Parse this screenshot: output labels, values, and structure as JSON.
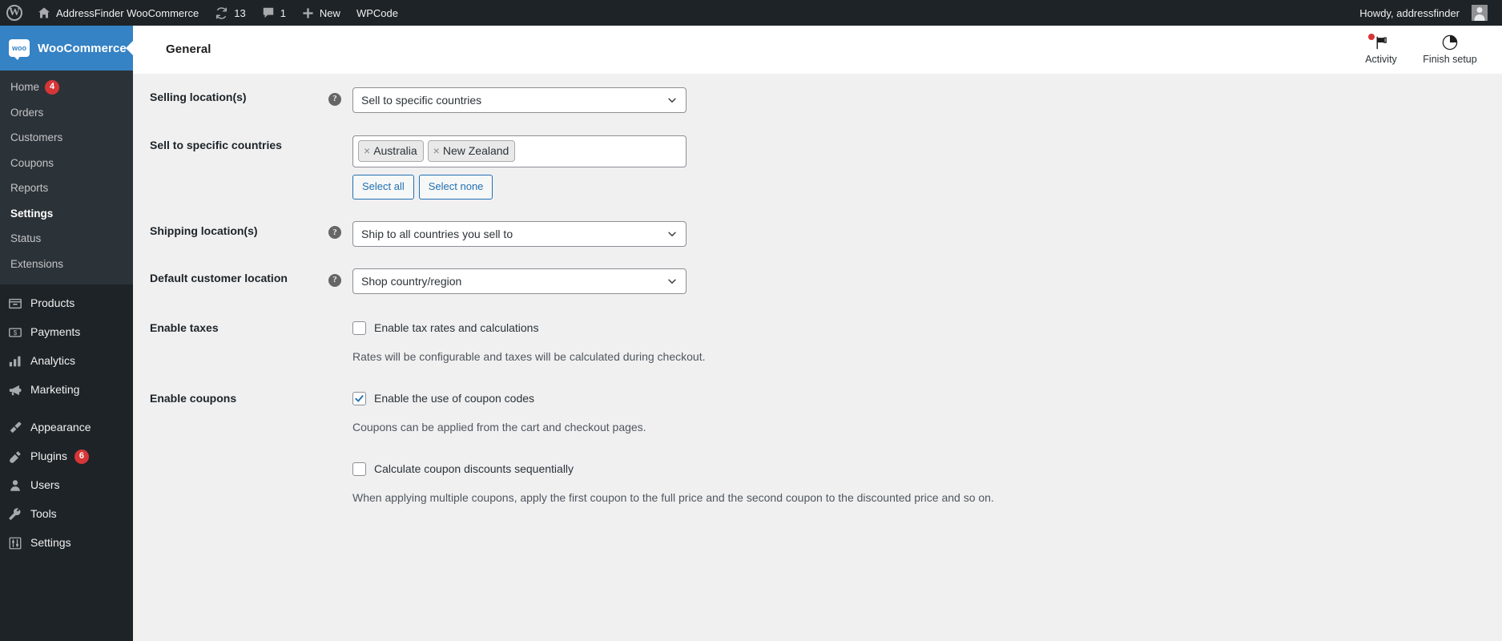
{
  "adminbar": {
    "site_name": "AddressFinder WooCommerce",
    "updates_count": "13",
    "comments_count": "1",
    "new_label": "New",
    "wpcode_label": "WPCode",
    "howdy": "Howdy, addressfinder",
    "icons": {
      "wp_logo": "wordpress-logo-icon",
      "home": "home-icon",
      "updates": "updates-icon",
      "comments": "comments-icon",
      "new": "plus-icon",
      "avatar": "avatar"
    }
  },
  "sidebar": {
    "brand": "WooCommerce",
    "submenu": [
      {
        "label": "Home",
        "badge": "4",
        "current": false
      },
      {
        "label": "Orders",
        "badge": "",
        "current": false
      },
      {
        "label": "Customers",
        "badge": "",
        "current": false
      },
      {
        "label": "Coupons",
        "badge": "",
        "current": false
      },
      {
        "label": "Reports",
        "badge": "",
        "current": false
      },
      {
        "label": "Settings",
        "badge": "",
        "current": true
      },
      {
        "label": "Status",
        "badge": "",
        "current": false
      },
      {
        "label": "Extensions",
        "badge": "",
        "current": false
      }
    ],
    "menu": [
      {
        "label": "Products",
        "icon": "products-icon",
        "badge": ""
      },
      {
        "label": "Payments",
        "icon": "payments-icon",
        "badge": ""
      },
      {
        "label": "Analytics",
        "icon": "analytics-icon",
        "badge": ""
      },
      {
        "label": "Marketing",
        "icon": "marketing-megaphone-icon",
        "badge": ""
      },
      {
        "label": "Appearance",
        "icon": "appearance-brush-icon",
        "badge": ""
      },
      {
        "label": "Plugins",
        "icon": "plugins-icon",
        "badge": "6"
      },
      {
        "label": "Users",
        "icon": "users-icon",
        "badge": ""
      },
      {
        "label": "Tools",
        "icon": "tools-wrench-icon",
        "badge": ""
      },
      {
        "label": "Settings",
        "icon": "settings-sliders-icon",
        "badge": ""
      }
    ]
  },
  "header": {
    "title": "General",
    "activity_label": "Activity",
    "finish_setup_label": "Finish setup"
  },
  "form": {
    "selling_locations": {
      "label": "Selling location(s)",
      "value": "Sell to specific countries",
      "help": "?"
    },
    "sell_to_specific_countries": {
      "label": "Sell to specific countries",
      "tokens": [
        "Australia",
        "New Zealand"
      ],
      "select_all": "Select all",
      "select_none": "Select none"
    },
    "shipping_locations": {
      "label": "Shipping location(s)",
      "value": "Ship to all countries you sell to",
      "help": "?"
    },
    "default_customer_location": {
      "label": "Default customer location",
      "value": "Shop country/region",
      "help": "?"
    },
    "enable_taxes": {
      "label": "Enable taxes",
      "checkbox_label": "Enable tax rates and calculations",
      "checked": false,
      "description": "Rates will be configurable and taxes will be calculated during checkout."
    },
    "enable_coupons": {
      "label": "Enable coupons",
      "checkbox_label": "Enable the use of coupon codes",
      "checked": true,
      "description": "Coupons can be applied from the cart and checkout pages.",
      "secondary_checkbox_label": "Calculate coupon discounts sequentially",
      "secondary_checked": false,
      "secondary_description": "When applying multiple coupons, apply the first coupon to the full price and the second coupon to the discounted price and so on."
    }
  },
  "colors": {
    "admin_dark": "#1d2327",
    "submenu_bg": "#2c3338",
    "woo_blue": "#3582c4",
    "link_blue": "#2271b1",
    "badge_red": "#d63638",
    "content_bg": "#f0f0f1"
  }
}
